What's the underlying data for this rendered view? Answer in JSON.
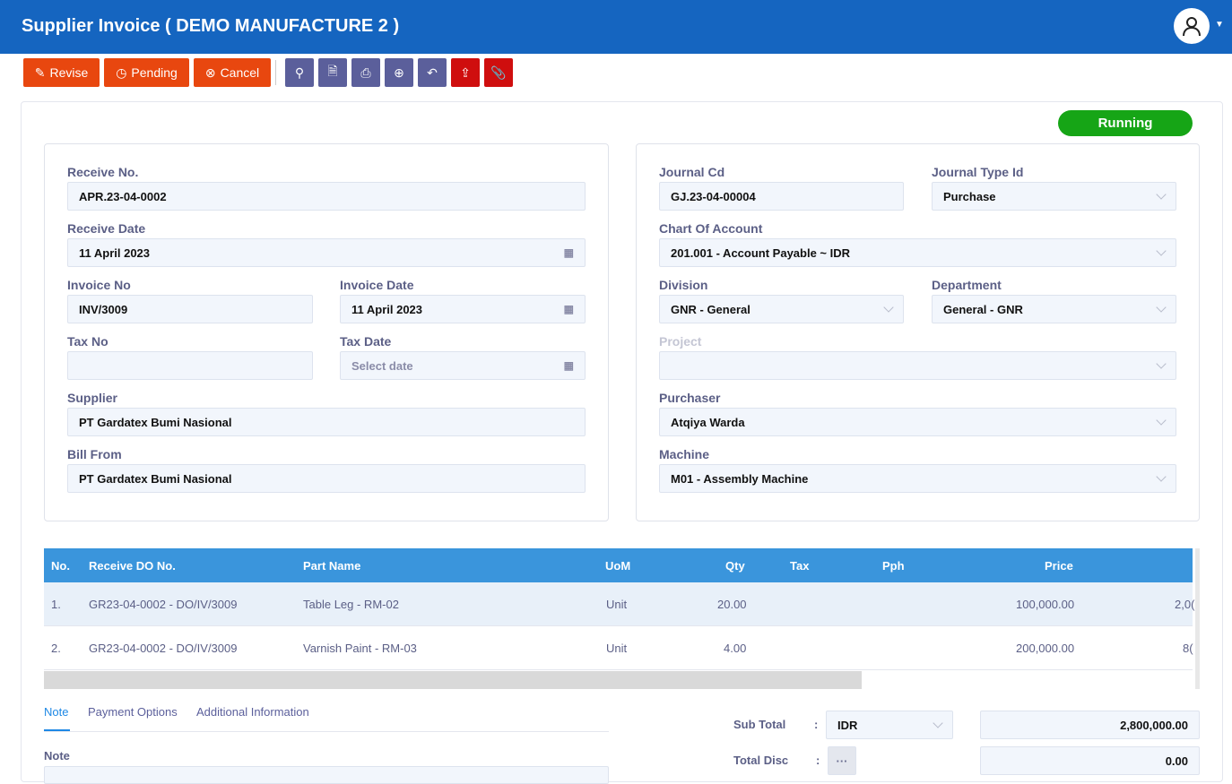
{
  "header": {
    "title": "Supplier Invoice ( DEMO MANUFACTURE 2 )"
  },
  "toolbar": {
    "revise": "Revise",
    "pending": "Pending",
    "cancel": "Cancel"
  },
  "status": "Running",
  "left": {
    "receive_no_label": "Receive No.",
    "receive_no": "APR.23-04-0002",
    "receive_date_label": "Receive Date",
    "receive_date": "11 April 2023",
    "invoice_no_label": "Invoice No",
    "invoice_no": "INV/3009",
    "invoice_date_label": "Invoice Date",
    "invoice_date": "11 April 2023",
    "tax_no_label": "Tax No",
    "tax_no": "",
    "tax_date_label": "Tax Date",
    "tax_date_placeholder": "Select date",
    "supplier_label": "Supplier",
    "supplier": "PT Gardatex Bumi Nasional",
    "bill_from_label": "Bill From",
    "bill_from": "PT Gardatex Bumi Nasional"
  },
  "right": {
    "journal_cd_label": "Journal Cd",
    "journal_cd": "GJ.23-04-00004",
    "journal_type_label": "Journal Type Id",
    "journal_type": "Purchase",
    "coa_label": "Chart Of Account",
    "coa": "201.001 - Account Payable ~ IDR",
    "division_label": "Division",
    "division": "GNR - General",
    "department_label": "Department",
    "department": "General - GNR",
    "project_label": "Project",
    "project": "",
    "purchaser_label": "Purchaser",
    "purchaser": "Atqiya Warda",
    "machine_label": "Machine",
    "machine": "M01 - Assembly Machine"
  },
  "table": {
    "headers": [
      "No.",
      "Receive DO No.",
      "Part Name",
      "UoM",
      "Qty",
      "Tax",
      "Pph",
      "Price"
    ],
    "rows": [
      [
        "1.",
        "GR23-04-0002 - DO/IV/3009",
        "Table Leg - RM-02",
        "Unit",
        "20.00",
        "100,000.00",
        "2,0("
      ],
      [
        "2.",
        "GR23-04-0002 - DO/IV/3009",
        "Varnish Paint - RM-03",
        "Unit",
        "4.00",
        "200,000.00",
        "8("
      ]
    ]
  },
  "tabs": [
    "Note",
    "Payment Options",
    "Additional Information"
  ],
  "note_label": "Note",
  "totals": {
    "sub_total_label": "Sub Total",
    "colon": ":",
    "currency": "IDR",
    "sub_total": "2,800,000.00",
    "total_disc_label": "Total Disc",
    "total_disc": "0.00",
    "more": "···"
  },
  "colors": {
    "header": "#1565c0",
    "action": "#e8470f",
    "tool": "#5b5f9b",
    "danger": "#cf0e0e",
    "running": "#16a516",
    "table_header": "#3a95dc"
  }
}
